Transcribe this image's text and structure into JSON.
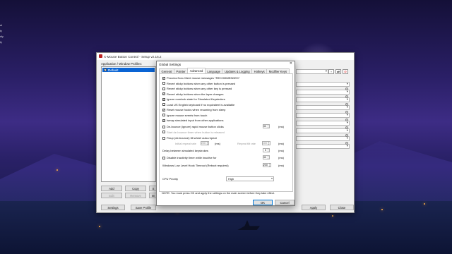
{
  "desktop": {
    "icons": [
      "ai",
      "ty",
      "rity",
      "ty"
    ]
  },
  "main_window": {
    "title": "X-Mouse Button Control - Setup v2.16.2",
    "profiles_label": "Application / Window Profiles:",
    "profile_default": "Default",
    "buttons": {
      "add": "Add",
      "copy": "Copy",
      "s": "S",
      "edit": "Edit",
      "remove": "Remove",
      "im": "Im",
      "settings": "Settings",
      "save_profile": "Save Profile",
      "apply": "Apply",
      "close": "Close"
    }
  },
  "dialog": {
    "title": "Global Settings",
    "close_glyph": "✕",
    "tabs": [
      "General",
      "Pointer",
      "Advanced",
      "Language",
      "Updates & Logging",
      "Hotkeys",
      "Modifier Keys"
    ],
    "active_tab": "Advanced",
    "options": [
      {
        "label": "Process Non-Client mouse messages *RECOMMENDED*",
        "checked": true
      },
      {
        "label": "Revert sticky buttons when any other button is pressed",
        "checked": false
      },
      {
        "label": "Revert sticky buttons when any other key is pressed",
        "checked": false
      },
      {
        "label": "Revert sticky buttons when the layer changes",
        "checked": true
      },
      {
        "label": "Ignore numlock state for Simulated Keystrokes",
        "checked": true
      },
      {
        "label": "Load US English keyboard if no equivalent is available",
        "checked": false
      },
      {
        "label": "Reset mouse hooks when resuming from sleep",
        "checked": true
      },
      {
        "label": "Ignore mouse events from touch",
        "checked": false
      },
      {
        "label": "Ismap simulated input from other applications",
        "checked": true
      },
      {
        "label": "De-bounce (ignore) rapid mouse button clicks",
        "checked": false
      },
      {
        "label": "Start de-bounce timer when button is released",
        "checked": false
      },
      {
        "label": "Fixup (de-bounce) tilt wheel auto-repeat",
        "checked": false
      }
    ],
    "debounce_value": "30",
    "unit_ms": "(ms)",
    "initial_repeat_label": "Initial repeat rate",
    "initial_repeat_value": "200",
    "repeat_tilt_label": "Repeat tilt rate",
    "repeat_tilt_value": "100",
    "delay_label": "Delay between simulated keystrokes",
    "delay_value": "5",
    "disable_inactivity_label": "Disable inactivity timer while inactive for",
    "disable_inactivity_checked": false,
    "disable_inactivity_value": "30",
    "hook_timeout_label": "Windows Low Level Hook Timeout (Reboot required)",
    "hook_timeout_value": "200",
    "cpu_priority_label": "CPU Priority",
    "cpu_priority_value": "High",
    "note": "NOTE: You must press OK and apply the settings on the main screen before they take effect.",
    "ok_label": "OK",
    "cancel_label": "Cancel"
  }
}
